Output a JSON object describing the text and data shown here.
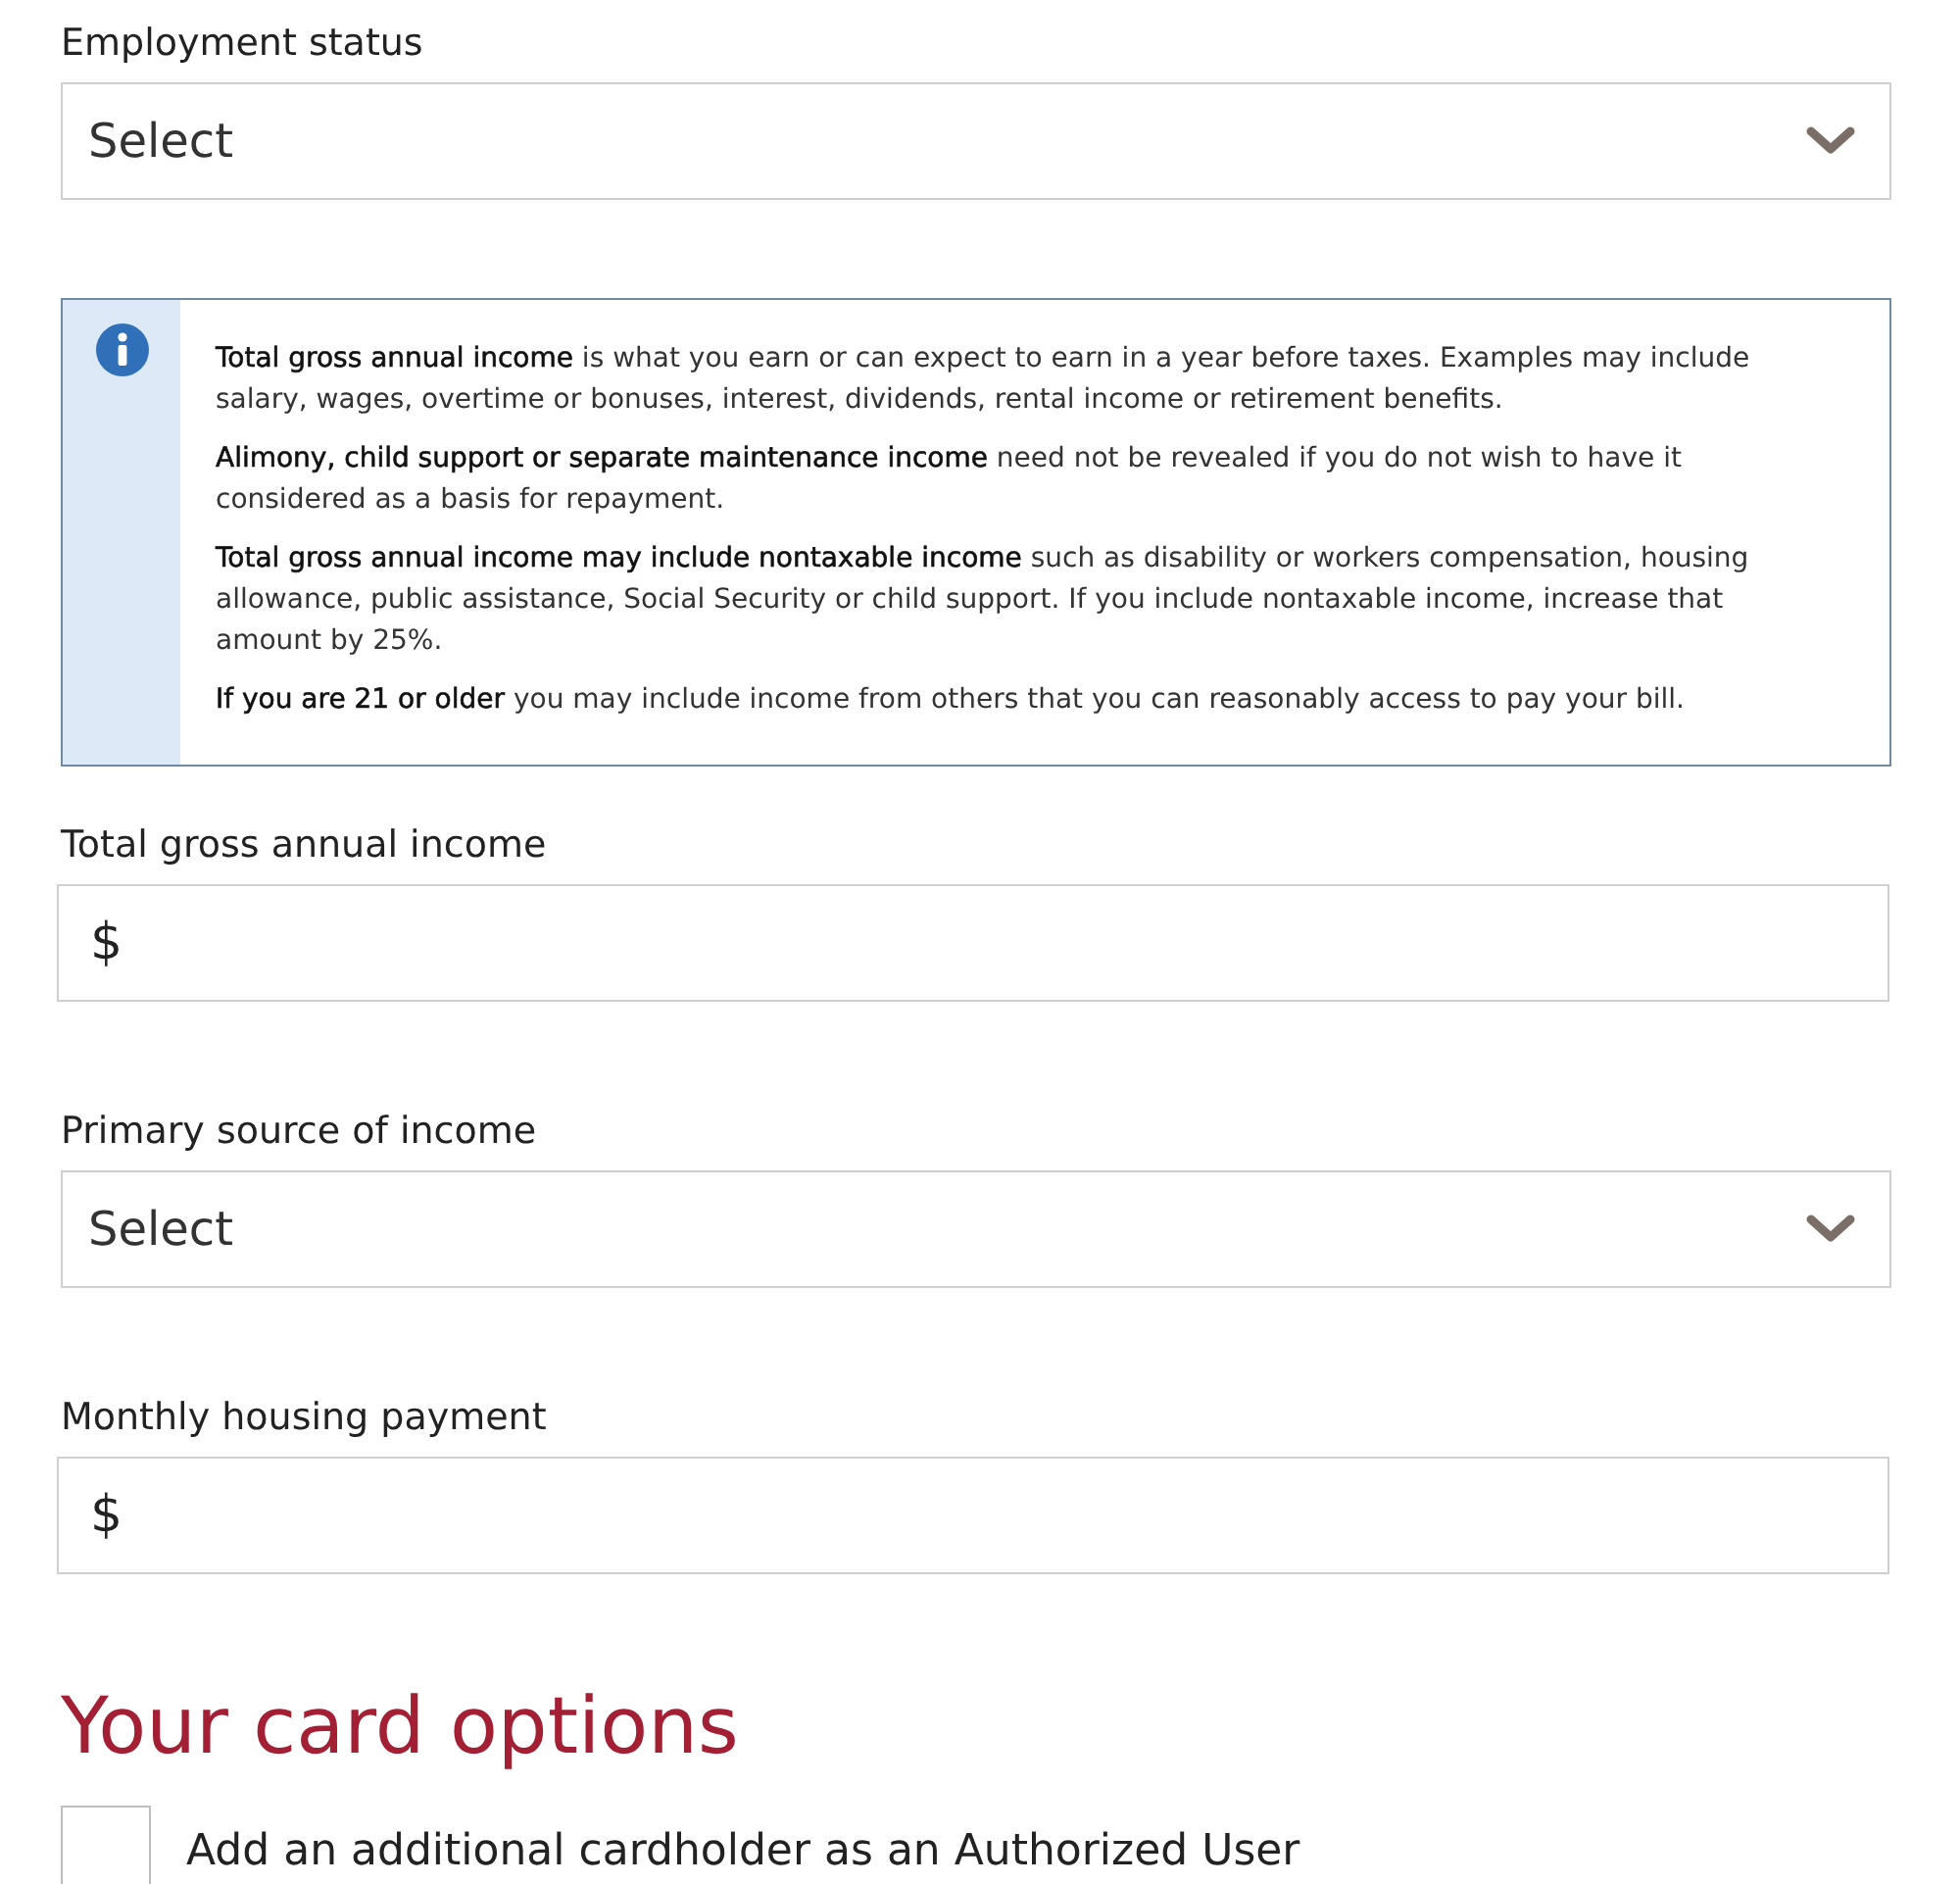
{
  "employment_status": {
    "label": "Employment status",
    "value": "Select"
  },
  "info": {
    "paragraphs": [
      "**Total gross annual income** is what you earn or can expect to earn in a year before taxes. Examples may include salary, wages, overtime or bonuses, interest, dividends, rental income or retirement benefits.",
      "**Alimony, child support or separate maintenance income** need not be revealed if you do not wish to have it considered as a basis for repayment.",
      "**Total gross annual income may include nontaxable income** such as disability or workers compensation, housing allowance, public assistance, Social Security or child support. If you include nontaxable income, increase that amount by 25%.",
      "**If you are 21 or older** you may include income from others that you can reasonably access to pay your bill."
    ]
  },
  "fields": [
    {
      "kind": "currency",
      "label": "Total gross annual income",
      "prefix": "$"
    },
    {
      "kind": "select",
      "label": "Primary source of income",
      "value": "Select"
    },
    {
      "kind": "currency",
      "label": "Monthly housing payment",
      "prefix": "$"
    }
  ],
  "card_options": {
    "heading": "Your card options",
    "checkbox": {
      "label": "Add an additional cardholder as an Authorized User",
      "checked": false
    }
  }
}
